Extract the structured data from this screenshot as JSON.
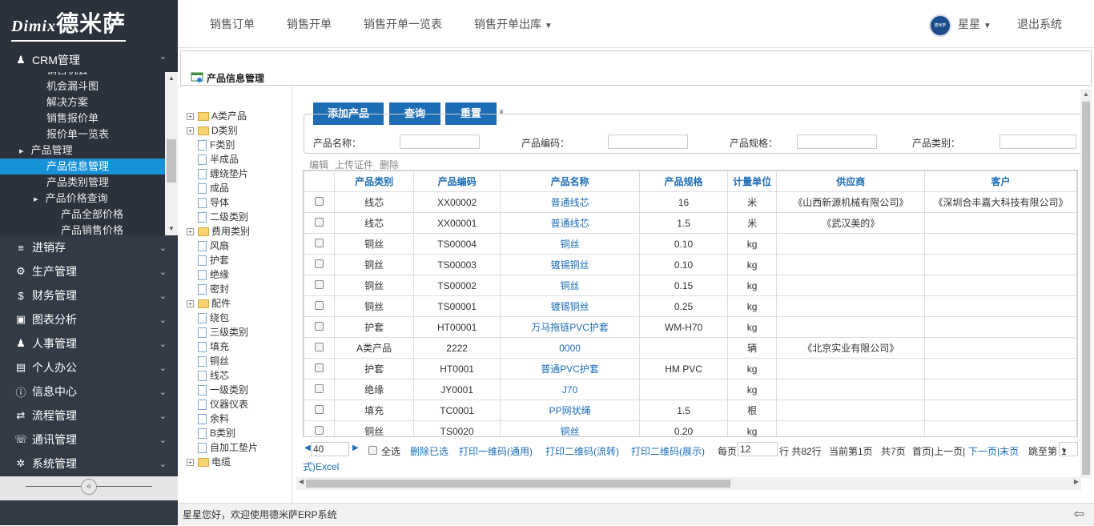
{
  "logo": {
    "latin": "Dimix",
    "cn": "德米萨"
  },
  "sidebar": {
    "crm": {
      "label": "CRM管理",
      "icon": "user-icon",
      "arrow": "⌃"
    },
    "sub": [
      {
        "label": "销售机会",
        "indent": 58
      },
      {
        "label": "机会漏斗图",
        "indent": 58
      },
      {
        "label": "解决方案",
        "indent": 58
      },
      {
        "label": "销售报价单",
        "indent": 58
      },
      {
        "label": "报价单一览表",
        "indent": 58
      },
      {
        "label": "产品管理",
        "indent": 40,
        "arrow": true
      },
      {
        "label": "产品信息管理",
        "indent": 58,
        "selected": true
      },
      {
        "label": "产品类别管理",
        "indent": 58
      },
      {
        "label": "产品价格查询",
        "indent": 58,
        "arrow": true
      },
      {
        "label": "产品全部价格",
        "indent": 76
      },
      {
        "label": "产品销售价格",
        "indent": 76
      }
    ],
    "groups": [
      {
        "label": "进销存",
        "icon": "list-icon",
        "glyph": "≡"
      },
      {
        "label": "生产管理",
        "icon": "cogs-icon",
        "glyph": "⚙"
      },
      {
        "label": "财务管理",
        "icon": "dollar-icon",
        "glyph": "$"
      },
      {
        "label": "图表分析",
        "icon": "picture-icon",
        "glyph": "▣"
      },
      {
        "label": "人事管理",
        "icon": "users-icon",
        "glyph": "♟"
      },
      {
        "label": "个人办公",
        "icon": "briefcase-icon",
        "glyph": "▤"
      },
      {
        "label": "信息中心",
        "icon": "info-icon",
        "glyph": "ⓘ"
      },
      {
        "label": "流程管理",
        "icon": "exchange-icon",
        "glyph": "⇄"
      },
      {
        "label": "通讯管理",
        "icon": "comments-icon",
        "glyph": "☏"
      },
      {
        "label": "系统管理",
        "icon": "gear-icon",
        "glyph": "✲"
      }
    ],
    "group_arrow": "⌄"
  },
  "topnav": {
    "items": [
      "销售订单",
      "销售开单",
      "销售开单一览表",
      "销售开单出库"
    ],
    "dropdown_arrow": "▼",
    "user": "星星",
    "logout": "退出系统"
  },
  "page": {
    "title": "产品信息管理"
  },
  "tree": [
    {
      "label": "A类产品",
      "type": "folder"
    },
    {
      "label": "D类别",
      "type": "folder"
    },
    {
      "label": "F类别",
      "type": "leaf"
    },
    {
      "label": "半成品",
      "type": "leaf"
    },
    {
      "label": "缠绕垫片",
      "type": "leaf"
    },
    {
      "label": "成品",
      "type": "leaf"
    },
    {
      "label": "导体",
      "type": "leaf"
    },
    {
      "label": "二级类别",
      "type": "leaf"
    },
    {
      "label": "费用类别",
      "type": "folder"
    },
    {
      "label": "风扇",
      "type": "leaf"
    },
    {
      "label": "护套",
      "type": "leaf"
    },
    {
      "label": "绝缘",
      "type": "leaf"
    },
    {
      "label": "密封",
      "type": "leaf"
    },
    {
      "label": "配件",
      "type": "folder"
    },
    {
      "label": "绕包",
      "type": "leaf"
    },
    {
      "label": "三级类别",
      "type": "leaf"
    },
    {
      "label": "填充",
      "type": "leaf"
    },
    {
      "label": "铜丝",
      "type": "leaf"
    },
    {
      "label": "线芯",
      "type": "leaf"
    },
    {
      "label": "一级类别",
      "type": "leaf"
    },
    {
      "label": "仪器仪表",
      "type": "leaf"
    },
    {
      "label": "余料",
      "type": "leaf"
    },
    {
      "label": "B类别",
      "type": "leaf"
    },
    {
      "label": "自加工垫片",
      "type": "leaf"
    },
    {
      "label": "电缆",
      "type": "folder"
    }
  ],
  "toolbar": {
    "add": "添加产品",
    "query": "查询",
    "reset": "重置",
    "expand": "»"
  },
  "search": {
    "name_label": "产品名称：",
    "code_label": "产品编码：",
    "spec_label": "产品规格：",
    "category_label": "产品类别："
  },
  "actions": {
    "edit": "编辑",
    "upload": "上传证件",
    "delete": "删除"
  },
  "table": {
    "headers": [
      "",
      "产品类别",
      "产品编码",
      "产品名称",
      "产品规格",
      "计量单位",
      "供应商",
      "客户"
    ],
    "rows": [
      [
        "线芯",
        "XX00002",
        "普通线芯",
        "16",
        "米",
        "《山西新源机械有限公司》",
        "《深圳合丰嘉大科技有限公司》"
      ],
      [
        "线芯",
        "XX00001",
        "普通线芯",
        "1.5",
        "米",
        "《武汉美的》",
        ""
      ],
      [
        "铜丝",
        "TS00004",
        "铜丝",
        "0.10",
        "kg",
        "",
        ""
      ],
      [
        "铜丝",
        "TS00003",
        "镀锡铜丝",
        "0.10",
        "kg",
        "",
        ""
      ],
      [
        "铜丝",
        "TS00002",
        "铜丝",
        "0.15",
        "kg",
        "",
        ""
      ],
      [
        "铜丝",
        "TS00001",
        "镀锡铜丝",
        "0.25",
        "kg",
        "",
        ""
      ],
      [
        "护套",
        "HT00001",
        "万马拖链PVC护套",
        "WM-H70",
        "kg",
        "",
        ""
      ],
      [
        "A类产品",
        "2222",
        "0000",
        "",
        "辆",
        "《北京实业有限公司》",
        ""
      ],
      [
        "护套",
        "HT0001",
        "普通PVC护套",
        "HM PVC",
        "kg",
        "",
        ""
      ],
      [
        "绝缘",
        "JY0001",
        "J70",
        "",
        "kg",
        "",
        ""
      ],
      [
        "填充",
        "TC0001",
        "PP网状绳",
        "1.5",
        "根",
        "",
        ""
      ],
      [
        "铜丝",
        "TS0020",
        "铜丝",
        "0.20",
        "kg",
        "",
        ""
      ]
    ]
  },
  "pager": {
    "page_size": "40",
    "select_all": "全选",
    "delete_selected": "删除已选",
    "print1": "打印一维码(通用)",
    "print2": "打印二维码(流转)",
    "print3": "打印二维码(展示)",
    "per_page_label": "每页",
    "per_page": "12",
    "total": "行 共82行",
    "current": "当前第1页",
    "pages": "共7页",
    "first_prev": "首页|上一页|",
    "next_last": "下一页|末页",
    "goto_label": "跳至第",
    "goto_value": "1",
    "excel": "式)Excel"
  },
  "footer": {
    "welcome": "星星您好，欢迎使用德米萨ERP系统",
    "back": "⇦"
  }
}
